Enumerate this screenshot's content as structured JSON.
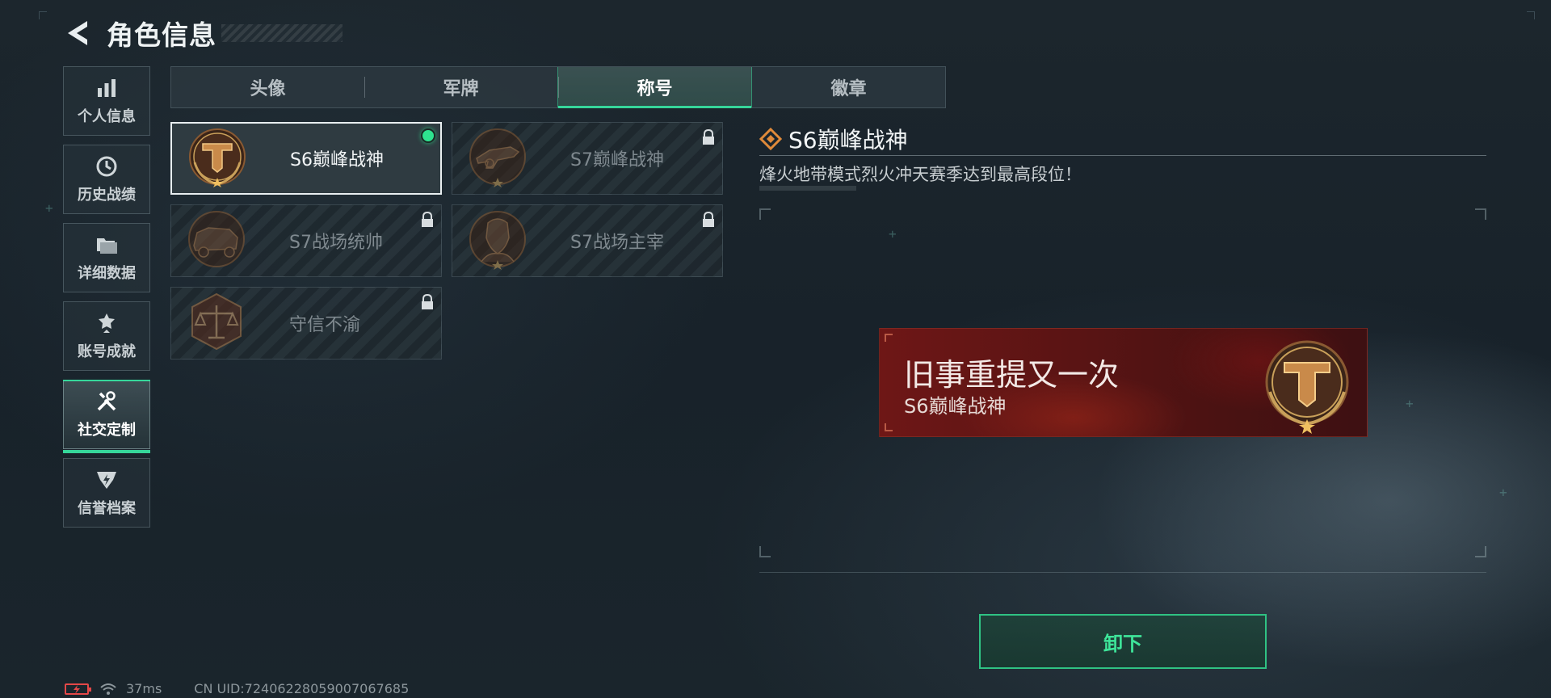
{
  "header": {
    "title": "角色信息"
  },
  "sidebar": {
    "items": [
      {
        "label": "个人信息",
        "icon": "bar-chart-icon"
      },
      {
        "label": "历史战绩",
        "icon": "history-clock-icon"
      },
      {
        "label": "详细数据",
        "icon": "folder-icon"
      },
      {
        "label": "账号成就",
        "icon": "achievement-icon"
      },
      {
        "label": "社交定制",
        "icon": "tools-icon",
        "active": true
      },
      {
        "label": "信誉档案",
        "icon": "credit-icon"
      }
    ]
  },
  "tabs": [
    {
      "label": "头像"
    },
    {
      "label": "军牌"
    },
    {
      "label": "称号",
      "active": true
    },
    {
      "label": "徽章"
    }
  ],
  "titles": [
    {
      "name": "S6巅峰战神",
      "selected": true,
      "equipped": true,
      "locked": false
    },
    {
      "name": "S7巅峰战神",
      "locked": true
    },
    {
      "name": "S7战场统帅",
      "locked": true
    },
    {
      "name": "S7战场主宰",
      "locked": true
    },
    {
      "name": "守信不渝",
      "locked": true
    }
  ],
  "detail": {
    "title": "S6巅峰战神",
    "description": "烽火地带模式烈火冲天赛季达到最高段位！"
  },
  "preview": {
    "player_name": "旧事重提又一次",
    "title": "S6巅峰战神"
  },
  "actions": {
    "unequip_label": "卸下"
  },
  "status": {
    "ping": "37ms",
    "uid": "CN UID:7240622805900706768​5"
  },
  "colors": {
    "accent": "#36d69a",
    "banner": "#6e1716",
    "emblem_gold": "#c9a05a"
  }
}
